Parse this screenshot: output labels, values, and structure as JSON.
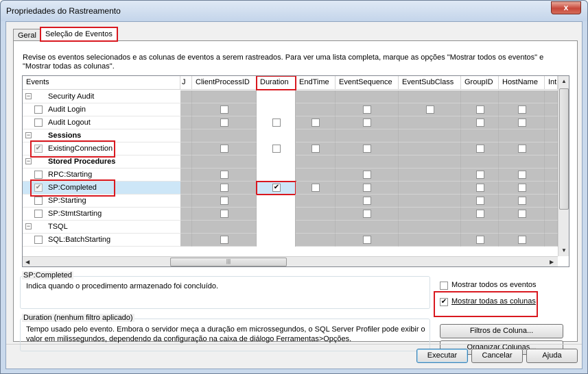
{
  "window": {
    "title": "Propriedades do Rastreamento",
    "close_glyph": "x"
  },
  "tabs": [
    {
      "label": "Geral",
      "active": false
    },
    {
      "label": "Seleção de Eventos",
      "active": true
    }
  ],
  "instructions": "Revise os eventos selecionados e as colunas de eventos a serem rastreados. Para ver uma lista completa, marque as opções \"Mostrar todos os eventos\" e \"Mostrar todas as colunas\".",
  "grid": {
    "event_header": "Events",
    "columns": [
      "J",
      "ClientProcessID",
      "Duration",
      "EndTime",
      "EventSequence",
      "EventSubClass",
      "GroupID",
      "HostName",
      "Int"
    ],
    "rows": [
      {
        "type": "category",
        "label": "Security Audit",
        "bold": false
      },
      {
        "type": "event",
        "label": "Audit Login"
      },
      {
        "type": "event",
        "label": "Audit Logout"
      },
      {
        "type": "category",
        "label": "Sessions",
        "bold": true
      },
      {
        "type": "event",
        "label": "ExistingConnection",
        "checked": true
      },
      {
        "type": "category",
        "label": "Stored Procedures",
        "bold": true
      },
      {
        "type": "event",
        "label": "RPC:Starting"
      },
      {
        "type": "event",
        "label": "SP:Completed",
        "checked": true,
        "selected": true
      },
      {
        "type": "event",
        "label": "SP:Starting"
      },
      {
        "type": "event",
        "label": "SP:StmtStarting"
      },
      {
        "type": "category",
        "label": "TSQL",
        "bold": false
      },
      {
        "type": "event",
        "label": "SQL:BatchStarting"
      }
    ],
    "checked_cell": {
      "row": "SP:Completed",
      "column": "Duration"
    }
  },
  "event_group": {
    "title": "SP:Completed",
    "text": "Indica quando o procedimento armazenado foi concluído."
  },
  "column_group": {
    "title": "Duration (nenhum filtro aplicado)",
    "text_line1": "Tempo usado pelo evento. Embora o servidor meça a duração em microssegundos, o SQL Server Profiler pode exibir o",
    "text_line2": "valor em milissegundos, dependendo da configuração na caixa de diálogo Ferramentas>Opções."
  },
  "options": {
    "show_all_events": {
      "label": "Mostrar todos os eventos",
      "checked": false
    },
    "show_all_columns": {
      "label": "Mostrar todas as colunas",
      "checked": true
    }
  },
  "buttons": {
    "column_filters": "Filtros de Coluna...",
    "organize_columns": "Organizar Colunas...",
    "run": "Executar",
    "cancel": "Cancelar",
    "help": "Ajuda"
  },
  "colors": {
    "highlight": "#d9181f",
    "selection": "#cde6f7",
    "gray_cell": "#c0c0c0"
  }
}
